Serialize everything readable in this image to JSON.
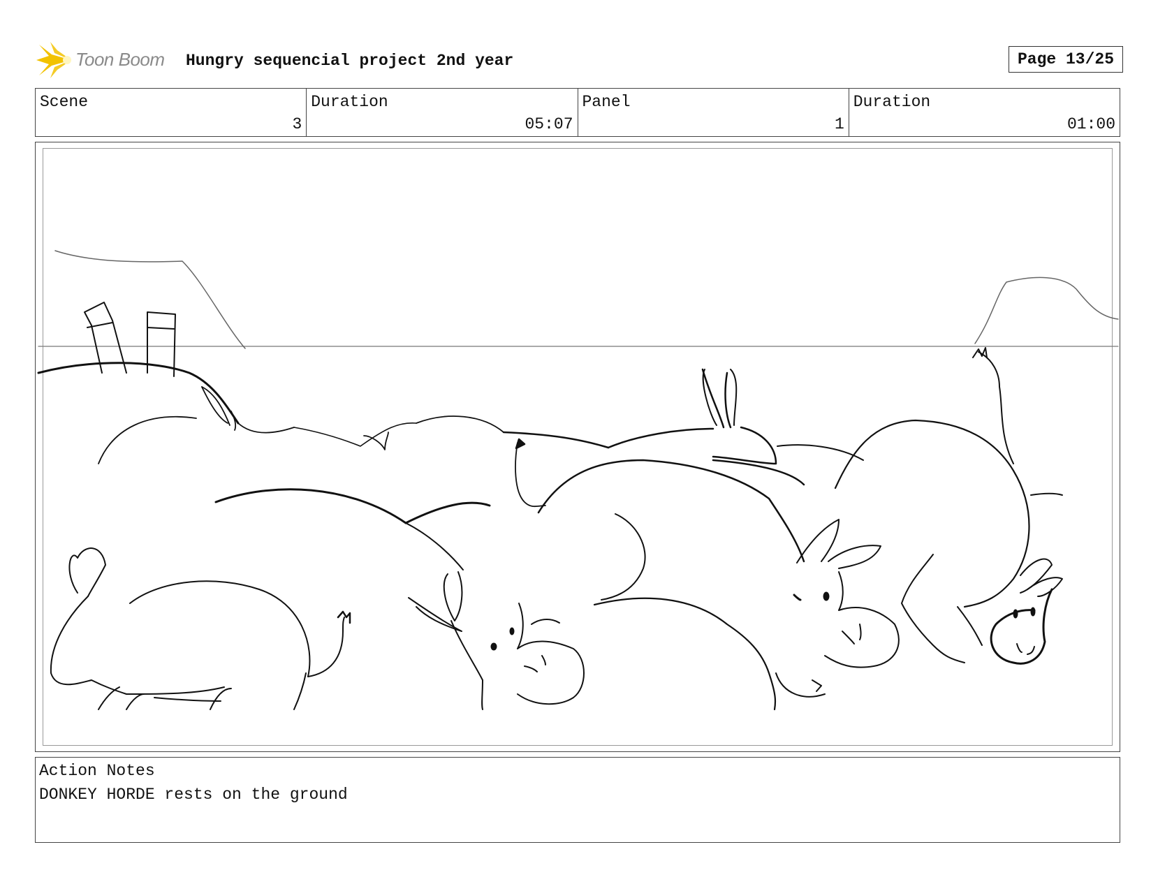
{
  "header": {
    "logo_text": "Toon Boom",
    "project_title": "Hungry sequencial project 2nd year",
    "page_label": "Page 13/25"
  },
  "info": {
    "scene_label": "Scene",
    "scene_value": "3",
    "scene_duration_label": "Duration",
    "scene_duration_value": "05:07",
    "panel_label": "Panel",
    "panel_value": "1",
    "panel_duration_label": "Duration",
    "panel_duration_value": "01:00"
  },
  "notes": {
    "label": "Action Notes",
    "text": "DONKEY HORDE rests on the ground"
  },
  "colors": {
    "logo_star": "#f2c200",
    "logo_text": "#8a8a8a",
    "sketch_line": "#111111",
    "horizon_line": "#777777"
  }
}
